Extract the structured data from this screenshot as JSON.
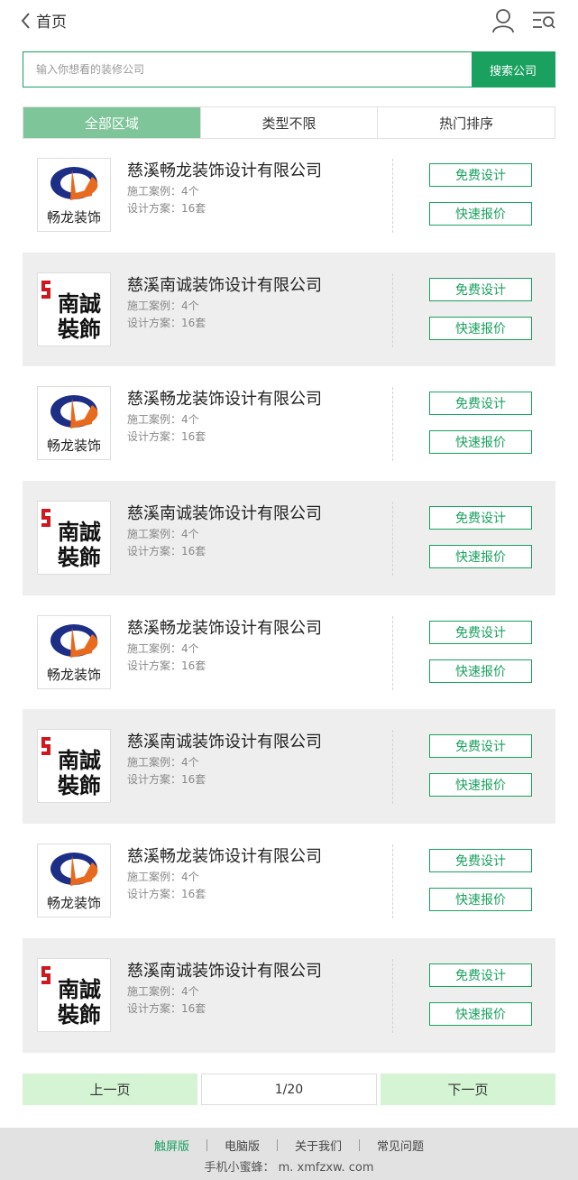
{
  "header": {
    "back_label": "首页"
  },
  "search": {
    "placeholder": "输入你想看的装修公司",
    "button_label": "搜索公司"
  },
  "filters": [
    {
      "label": "全部区域",
      "active": true
    },
    {
      "label": "类型不限",
      "active": false
    },
    {
      "label": "热门排序",
      "active": false
    }
  ],
  "companies": [
    {
      "name": "慈溪畅龙装饰设计有限公司",
      "cases": "施工案例：4个",
      "plans": "设计方案：16套",
      "logo": "changlong-logo",
      "logo_text": "畅龙装饰",
      "btn_design": "免费设计",
      "btn_quote": "快速报价"
    },
    {
      "name": "慈溪南诚装饰设计有限公司",
      "cases": "施工案例：4个",
      "plans": "设计方案：16套",
      "logo": "nancheng-logo",
      "logo_text": [
        "南誠",
        "裝飾"
      ],
      "btn_design": "免费设计",
      "btn_quote": "快速报价"
    },
    {
      "name": "慈溪畅龙装饰设计有限公司",
      "cases": "施工案例：4个",
      "plans": "设计方案：16套",
      "logo": "changlong-logo",
      "logo_text": "畅龙装饰",
      "btn_design": "免费设计",
      "btn_quote": "快速报价"
    },
    {
      "name": "慈溪南诚装饰设计有限公司",
      "cases": "施工案例：4个",
      "plans": "设计方案：16套",
      "logo": "nancheng-logo",
      "logo_text": [
        "南誠",
        "裝飾"
      ],
      "btn_design": "免费设计",
      "btn_quote": "快速报价"
    },
    {
      "name": "慈溪畅龙装饰设计有限公司",
      "cases": "施工案例：4个",
      "plans": "设计方案：16套",
      "logo": "changlong-logo",
      "logo_text": "畅龙装饰",
      "btn_design": "免费设计",
      "btn_quote": "快速报价"
    },
    {
      "name": "慈溪南诚装饰设计有限公司",
      "cases": "施工案例：4个",
      "plans": "设计方案：16套",
      "logo": "nancheng-logo",
      "logo_text": [
        "南誠",
        "裝飾"
      ],
      "btn_design": "免费设计",
      "btn_quote": "快速报价"
    },
    {
      "name": "慈溪畅龙装饰设计有限公司",
      "cases": "施工案例：4个",
      "plans": "设计方案：16套",
      "logo": "changlong-logo",
      "logo_text": "畅龙装饰",
      "btn_design": "免费设计",
      "btn_quote": "快速报价"
    },
    {
      "name": "慈溪南诚装饰设计有限公司",
      "cases": "施工案例：4个",
      "plans": "设计方案：16套",
      "logo": "nancheng-logo",
      "logo_text": [
        "南誠",
        "裝飾"
      ],
      "btn_design": "免费设计",
      "btn_quote": "快速报价"
    }
  ],
  "pager": {
    "prev_label": "上一页",
    "page_info": "1/20",
    "next_label": "下一页"
  },
  "footer": {
    "links": [
      {
        "label": "触屏版",
        "active": true
      },
      {
        "label": "电脑版",
        "active": false
      },
      {
        "label": "关于我们",
        "active": false
      },
      {
        "label": "常见问题",
        "active": false
      }
    ],
    "domain": "手机小蜜蜂：  m. xmfzxw. com"
  },
  "colors": {
    "accent": "#1aa160",
    "tab_active_bg": "#7ec59a",
    "pager_bg": "#d4f4d4",
    "row_alt_bg": "#eeeeee"
  }
}
